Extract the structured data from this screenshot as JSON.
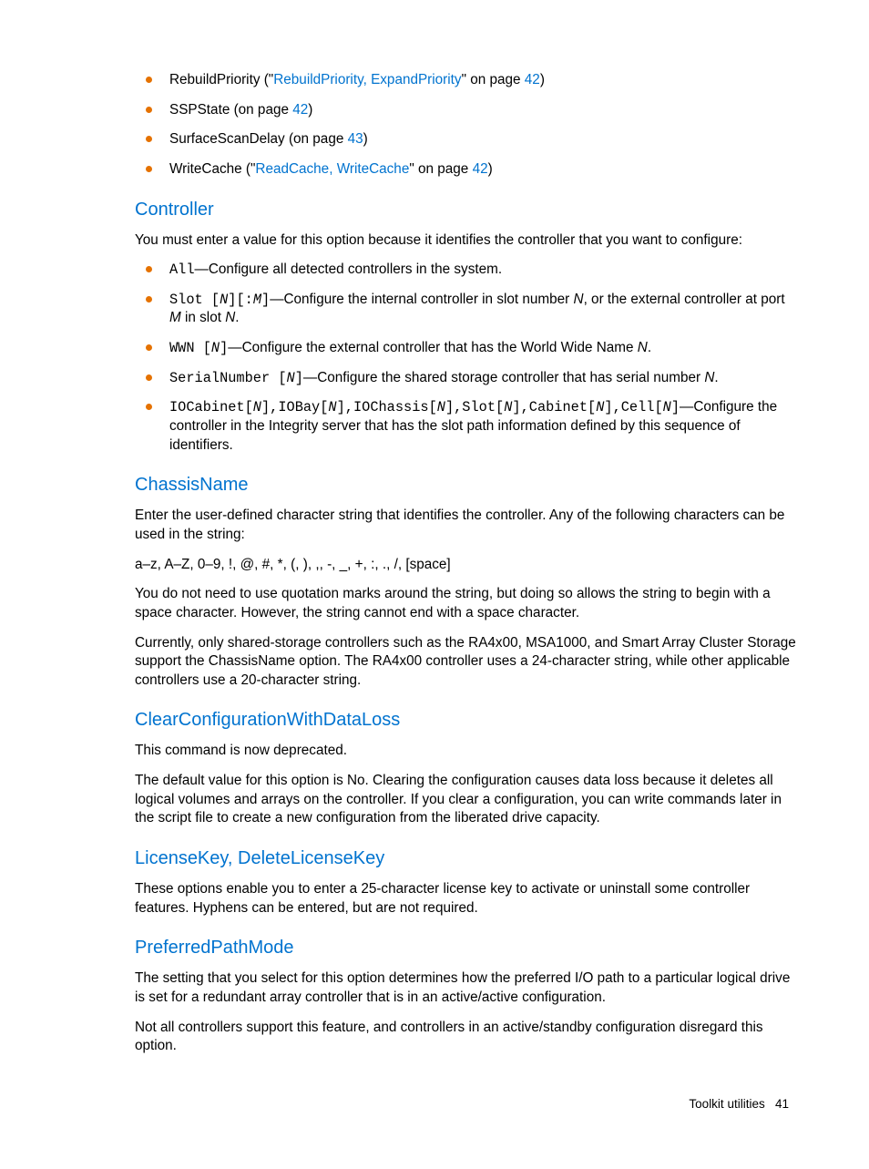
{
  "top_list": [
    {
      "pre": "RebuildPriority (\"",
      "link": "RebuildPriority, ExpandPriority",
      "mid": "\" on page ",
      "page": "42",
      "post": ")"
    },
    {
      "pre": "SSPState (on page ",
      "link": "",
      "mid": "",
      "page": "42",
      "post": ")"
    },
    {
      "pre": "SurfaceScanDelay (on page ",
      "link": "",
      "mid": "",
      "page": "43",
      "post": ")"
    },
    {
      "pre": "WriteCache (\"",
      "link": "ReadCache, WriteCache",
      "mid": "\" on page ",
      "page": "42",
      "post": ")"
    }
  ],
  "controller": {
    "heading": "Controller",
    "intro": "You must enter a value for this option because it identifies the controller that you want to configure:",
    "bullets": [
      {
        "code_a": "All",
        "body_a": "—Configure all detected controllers in the system."
      },
      {
        "code_a": "Slot [",
        "ital_a": "N",
        "code_b": "][:",
        "ital_b": "M",
        "code_c": "]",
        "body_a": "—Configure the internal controller in slot number ",
        "ital_c": "N",
        "body_b": ", or the external controller at port ",
        "ital_d": "M",
        "body_c": " in slot ",
        "ital_e": "N",
        "body_d": "."
      },
      {
        "code_a": "WWN [",
        "ital_a": "N",
        "code_b": "]",
        "body_a": "—Configure the external controller that has the World Wide Name ",
        "ital_b": "N",
        "body_b": "."
      },
      {
        "code_a": "SerialNumber [",
        "ital_a": "N",
        "code_b": "]",
        "body_a": "—Configure the shared storage controller that has serial number ",
        "ital_b": "N",
        "body_b": "."
      },
      {
        "code_a": "IOCabinet[",
        "ital_a": "N",
        "code_b": "],IOBay[",
        "ital_b": "N",
        "code_c": "],IOChassis[",
        "ital_c": "N",
        "code_d": "],Slot[",
        "ital_d": "N",
        "code_e": "],Cabinet[",
        "ital_e": "N",
        "code_f": "],Cell[",
        "ital_f": "N",
        "code_g": "]",
        "body_a": "—Configure the controller in the Integrity server that has the slot path information defined by this sequence of identifiers."
      }
    ]
  },
  "chassis": {
    "heading": "ChassisName",
    "p1": "Enter the user-defined character string that identifies the controller. Any of the following characters can be used in the string:",
    "p2": "a–z, A–Z, 0–9, !, @, #, *, (, ), ,, -, _, +, :, ., /, [space]",
    "p3": "You do not need to use quotation marks around the string, but doing so allows the string to begin with a space character. However, the string cannot end with a space character.",
    "p4": "Currently, only shared-storage controllers such as the RA4x00, MSA1000, and Smart Array Cluster Storage support the ChassisName option. The RA4x00 controller uses a 24-character string, while other applicable controllers use a 20-character string."
  },
  "clearcfg": {
    "heading": "ClearConfigurationWithDataLoss",
    "p1": "This command is now deprecated.",
    "p2": "The default value for this option is No. Clearing the configuration causes data loss because it deletes all logical volumes and arrays on the controller. If you clear a configuration, you can write commands later in the script file to create a new configuration from the liberated drive capacity."
  },
  "license": {
    "heading": "LicenseKey, DeleteLicenseKey",
    "p1": "These options enable you to enter a 25-character license key to activate or uninstall some controller features. Hyphens can be entered, but are not required."
  },
  "ppm": {
    "heading": "PreferredPathMode",
    "p1": "The setting that you select for this option determines how the preferred I/O path to a particular logical drive is set for a redundant array controller that is in an active/active configuration.",
    "p2": "Not all controllers support this feature, and controllers in an active/standby configuration disregard this option."
  },
  "footer": {
    "label": "Toolkit utilities",
    "page": "41"
  }
}
